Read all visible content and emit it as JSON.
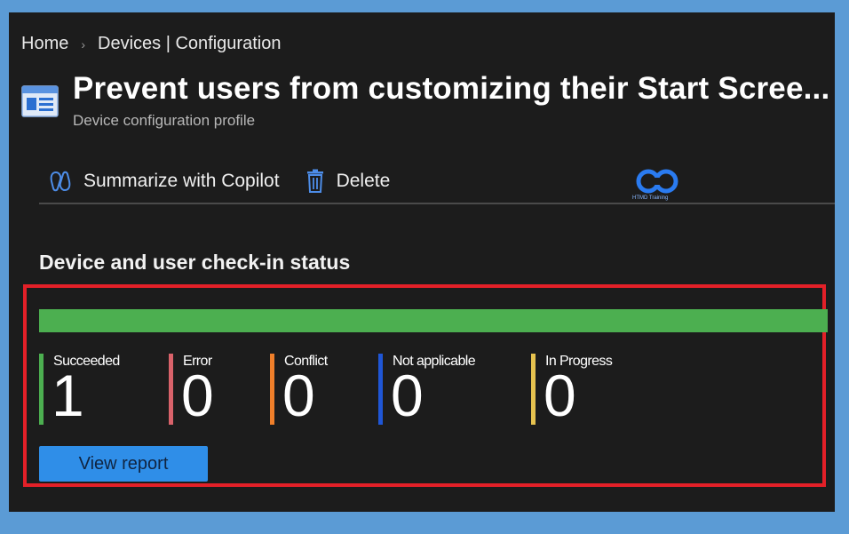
{
  "breadcrumb": {
    "home": "Home",
    "current": "Devices | Configuration"
  },
  "header": {
    "title": "Prevent users from customizing their Start Scree...",
    "subtitle": "Device configuration profile",
    "icon": "profile-icon"
  },
  "toolbar": {
    "copilot_label": "Summarize with Copilot",
    "delete_label": "Delete"
  },
  "logo": {
    "text": "HTMD Training"
  },
  "checkin": {
    "section_title": "Device and user check-in status",
    "view_report_label": "View report",
    "progress": {
      "succeeded_fraction": 1.0,
      "color": "#4caf50"
    },
    "statuses": [
      {
        "label": "Succeeded",
        "value": "1",
        "color": "#4caf50"
      },
      {
        "label": "Error",
        "value": "0",
        "color": "#d9626a"
      },
      {
        "label": "Conflict",
        "value": "0",
        "color": "#f07f2a"
      },
      {
        "label": "Not applicable",
        "value": "0",
        "color": "#1f56d6"
      },
      {
        "label": "In Progress",
        "value": "0",
        "color": "#e6c24f"
      }
    ]
  },
  "colors": {
    "background": "#1c1c1c",
    "accent": "#2f8ee8",
    "highlight": "#e32028"
  }
}
